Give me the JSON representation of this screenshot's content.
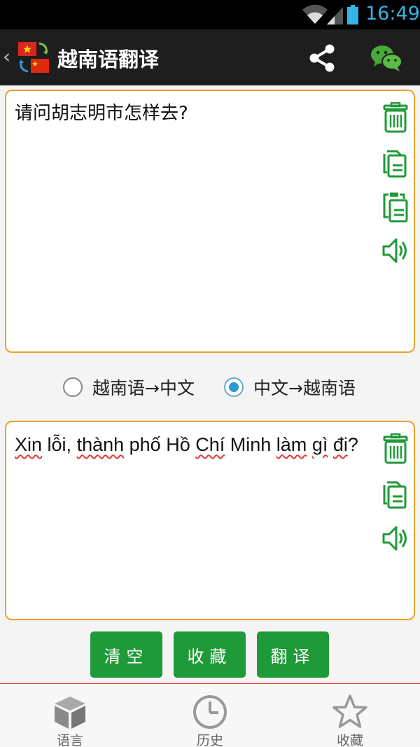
{
  "status_bar": {
    "time": "16:49"
  },
  "app_bar": {
    "title": "越南语翻译",
    "back_icon": "chevron-left-icon",
    "share_icon": "share-icon",
    "wechat_icon": "wechat-icon"
  },
  "input": {
    "text": "请问胡志明市怎样去?"
  },
  "output": {
    "segments": [
      {
        "t": "Xin",
        "u": true
      },
      {
        "t": " lỗi, ",
        "u": false
      },
      {
        "t": "thành",
        "u": true
      },
      {
        "t": " phố Hồ ",
        "u": false
      },
      {
        "t": "Chí",
        "u": true
      },
      {
        "t": " Minh ",
        "u": false
      },
      {
        "t": "làm",
        "u": true
      },
      {
        "t": " ",
        "u": false
      },
      {
        "t": "gì",
        "u": true
      },
      {
        "t": " ",
        "u": false
      },
      {
        "t": "đi",
        "u": true
      },
      {
        "t": "?",
        "u": false
      }
    ]
  },
  "direction": {
    "vi_to_zh": {
      "label": "越南语→中文",
      "selected": false
    },
    "zh_to_vi": {
      "label": "中文→越南语",
      "selected": true
    }
  },
  "buttons": {
    "clear": "清空",
    "favorite": "收藏",
    "translate": "翻译"
  },
  "bottom_nav": {
    "language": "语言",
    "history": "历史",
    "favorites": "收藏"
  },
  "colors": {
    "accent_green": "#1f9a38",
    "pane_border": "#f0a028",
    "time_blue": "#33b5e5"
  }
}
